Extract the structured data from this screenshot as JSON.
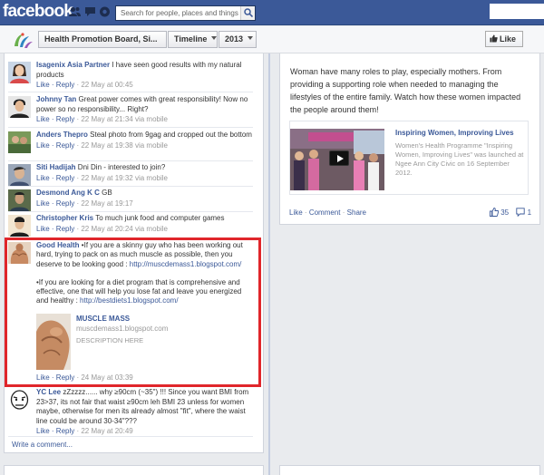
{
  "topbar": {
    "logo": "facebook",
    "search_placeholder": "Search for people, places and things"
  },
  "page_header": {
    "page_name": "Health Promotion Board, Si...",
    "timeline_label": "Timeline",
    "year_label": "2013",
    "like_label": "Like"
  },
  "comments": [
    {
      "name": "Isagenix Asia Partner",
      "text": "I have seen good results with my natural products",
      "meta_prefix": "Like · Reply",
      "meta_time": " · 22 May at 00:45"
    },
    {
      "name": "Johnny Tan",
      "text": "Great power comes with great responsibility! Now no power so no responsibility... Right?",
      "meta_prefix": "Like · Reply",
      "meta_time": " · 22 May at 21:34 via mobile"
    },
    {
      "name": "Anders Thepro",
      "text": "Steal photo from 9gag and cropped out the bottom",
      "meta_prefix": "Like · Reply",
      "meta_time": " · 22 May at 19:38 via mobile"
    },
    {
      "name": "Siti Hadijah",
      "text": "Dni Din - interested to join?",
      "meta_prefix": "Like · Reply",
      "meta_time": " · 22 May at 19:32 via mobile"
    },
    {
      "name": "Desmond Ang K C",
      "text": "GB",
      "meta_prefix": "Like · Reply",
      "meta_time": " · 22 May at 19:17"
    },
    {
      "name": "Christopher Kris",
      "text": "To much junk food and computer games",
      "meta_prefix": "Like · Reply",
      "meta_time": " · 22 May at 20:24 via mobile"
    }
  ],
  "highlighted_comment": {
    "name": "Good Health",
    "text1": "•If you are a skinny guy who has been working out hard, trying to pack on as much muscle as possible, then you deserve to be looking good : ",
    "link1": "http://muscdemass1.blogspot.com/",
    "text2": "•If you are looking for a diet program that is comprehensive and effective, one that will help you lose fat and leave you energized and healthy : ",
    "link2": "http://bestdiets1.blogspot.com/",
    "attachment": {
      "title": "MUSCLE MASS",
      "domain": "muscdemass1.blogspot.com",
      "description": "DESCRIPTION HERE"
    },
    "meta_prefix": "Like · Reply",
    "meta_time": " · 24 May at 03:39"
  },
  "last_comment": {
    "name": "YC Lee",
    "text": "zZzzzz...... why ≥90cm (~35\") !!! Since you want BMI from 23>37, its not fair that waist ≥90cm leh BMI 23 unless for women maybe, otherwise for men its already almost \"fit\", where the waist line could be around 30-34\"???",
    "meta_prefix": "Like · Reply",
    "meta_time": " · 22 May at 20:49"
  },
  "write_comment": "Write a comment...",
  "right_post": {
    "text": "Woman have many roles to play, especially mothers. From providing a supporting role when needed to managing the lifestyles of the entire family. Watch how these women impacted the people around them!",
    "share_title": "Inspiring Women, Improving Lives",
    "share_desc": "Women's Health Programme \"Inspiring Women, Improving Lives\" was launched at Ngee Ann City Civic on 16 September 2012.",
    "action_like": "Like",
    "action_comment": "Comment",
    "action_share": "Share",
    "like_count": "35",
    "comment_count": "1"
  },
  "colors": {
    "brand_blue": "#3b5998",
    "highlight_red": "#e0262b"
  }
}
